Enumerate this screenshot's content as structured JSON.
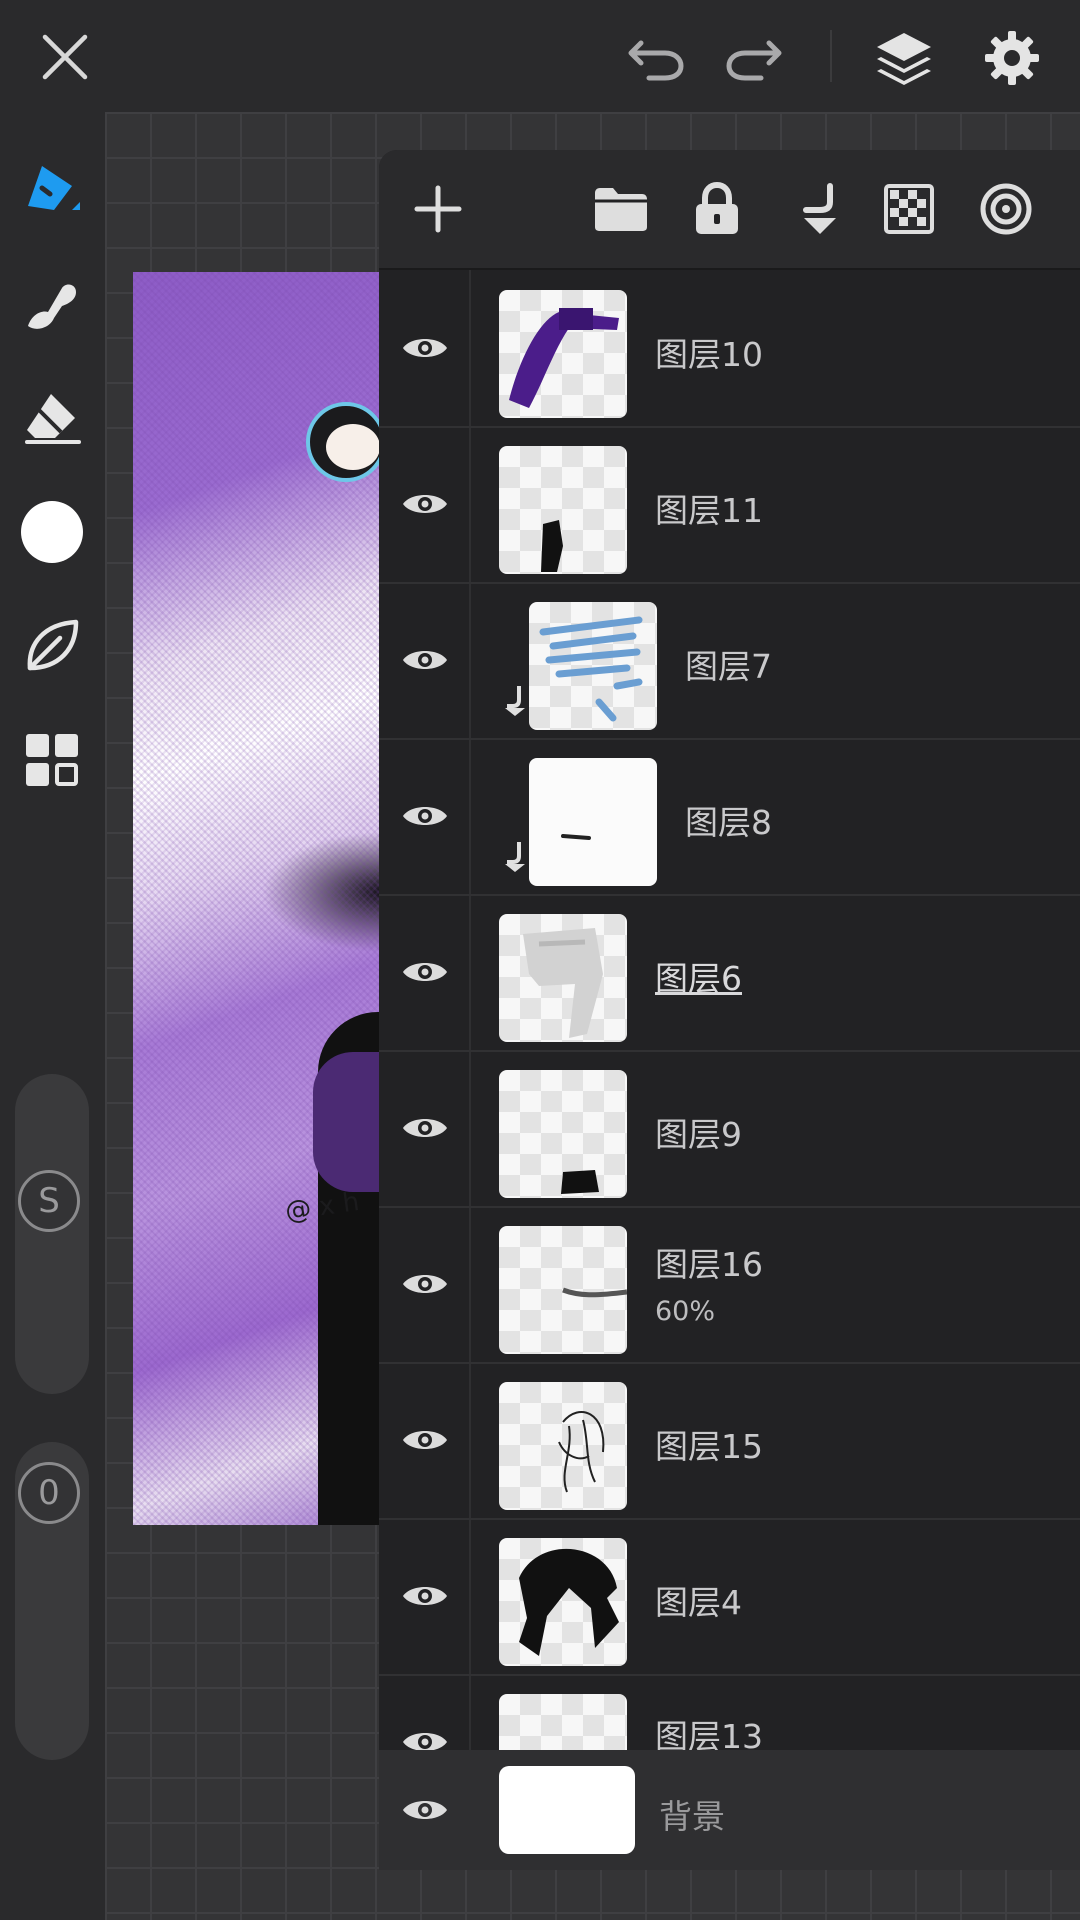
{
  "toolbar": {
    "close_icon": "close-icon",
    "undo_icon": "undo-icon",
    "redo_icon": "redo-icon",
    "layers_icon": "layers-icon",
    "settings_icon": "gear-icon"
  },
  "tools": [
    "pen-icon",
    "smudge-icon",
    "eraser-icon",
    "color-icon",
    "leaf-icon",
    "grid-icon"
  ],
  "size_slider": {
    "label": "S"
  },
  "opacity_slider": {
    "label": "0"
  },
  "artwork": {
    "signature": "@ x h"
  },
  "layer_panel": {
    "actions": [
      "add-layer-icon",
      "folder-icon",
      "lock-icon",
      "merge-down-icon",
      "transparency-icon",
      "blend-icon"
    ],
    "layers": [
      {
        "name": "图层10",
        "clipped": false,
        "opacity": ""
      },
      {
        "name": "图层11",
        "clipped": false,
        "opacity": ""
      },
      {
        "name": "图层7",
        "clipped": true,
        "opacity": ""
      },
      {
        "name": "图层8",
        "clipped": true,
        "opacity": ""
      },
      {
        "name": "图层6",
        "clipped": false,
        "opacity": "",
        "selected": true
      },
      {
        "name": "图层9",
        "clipped": false,
        "opacity": ""
      },
      {
        "name": "图层16",
        "clipped": false,
        "opacity": "60%"
      },
      {
        "name": "图层15",
        "clipped": false,
        "opacity": ""
      },
      {
        "name": "图层4",
        "clipped": false,
        "opacity": ""
      },
      {
        "name": "图层13",
        "clipped": false,
        "opacity": ""
      }
    ],
    "background_layer": {
      "name": "背景"
    }
  }
}
